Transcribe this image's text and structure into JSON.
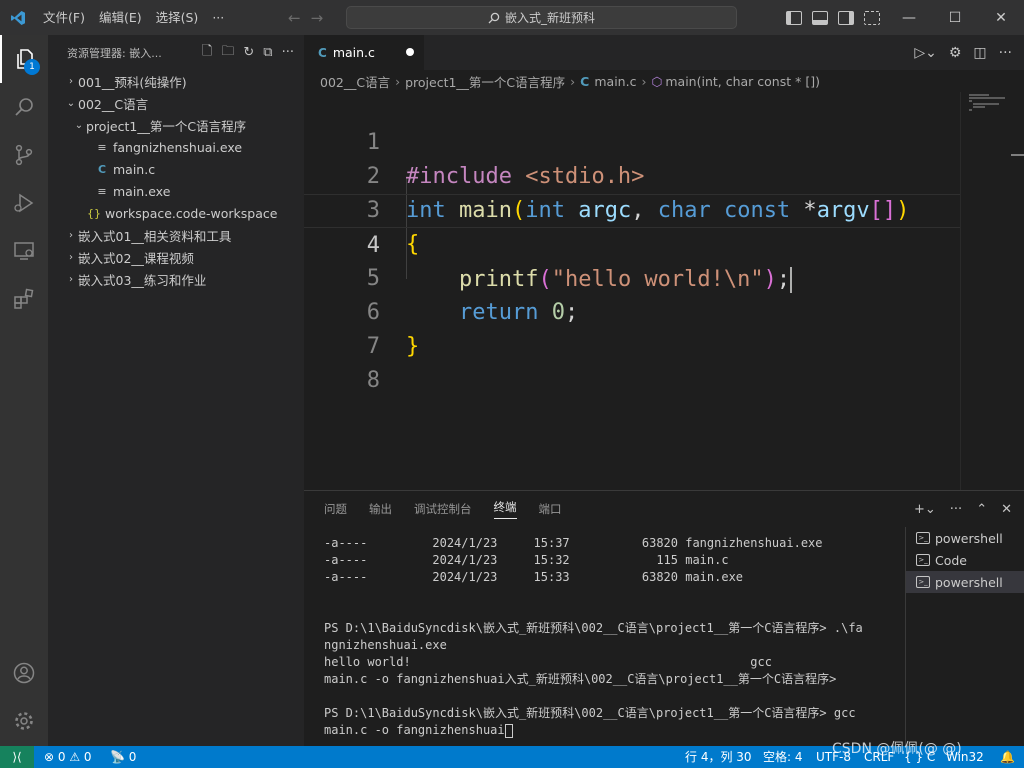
{
  "titlebar": {
    "menu": [
      "文件(F)",
      "编辑(E)",
      "选择(S)",
      "···"
    ],
    "search_text": "嵌入式_新班预科"
  },
  "activity": {
    "explorer_badge": "1"
  },
  "sidebar": {
    "title": "资源管理器: 嵌入...",
    "tree": [
      {
        "label": "001__预科(纯操作)",
        "indent": 0,
        "chev": "›",
        "icon": ""
      },
      {
        "label": "002__C语言",
        "indent": 0,
        "chev": "⌄",
        "icon": ""
      },
      {
        "label": "project1__第一个C语言程序",
        "indent": 1,
        "chev": "⌄",
        "icon": ""
      },
      {
        "label": "fangnizhenshuai.exe",
        "indent": 2,
        "chev": "",
        "icon": "≡"
      },
      {
        "label": "main.c",
        "indent": 2,
        "chev": "",
        "icon": "C"
      },
      {
        "label": "main.exe",
        "indent": 2,
        "chev": "",
        "icon": "≡"
      },
      {
        "label": "workspace.code-workspace",
        "indent": 1,
        "chev": "",
        "icon": "{}"
      },
      {
        "label": "嵌入式01__相关资料和工具",
        "indent": 0,
        "chev": "›",
        "icon": ""
      },
      {
        "label": "嵌入式02__课程视频",
        "indent": 0,
        "chev": "›",
        "icon": ""
      },
      {
        "label": "嵌入式03__练习和作业",
        "indent": 0,
        "chev": "›",
        "icon": ""
      }
    ]
  },
  "editor": {
    "tab_label": "main.c",
    "breadcrumb": [
      "002__C语言",
      "project1__第一个C语言程序",
      "main.c",
      "main(int, char const * [])"
    ],
    "line_numbers": [
      "1",
      "2",
      "3",
      "4",
      "5",
      "6",
      "7",
      "8"
    ],
    "code": {
      "l1_directive": "#include",
      "l1_header": "<stdio.h>",
      "l2_int": "int",
      "l2_main": "main",
      "l2_int2": "int",
      "l2_argc": "argc",
      "l2_char": "char",
      "l2_const": "const",
      "l2_argv": "argv",
      "l3_brace": "{",
      "l4_printf": "printf",
      "l4_string": "\"hello world!\\n\"",
      "l5_return": "return",
      "l5_zero": "0",
      "l6_brace": "}"
    }
  },
  "panel": {
    "tabs": [
      "问题",
      "输出",
      "调试控制台",
      "终端",
      "端口"
    ],
    "active_tab": "终端",
    "terminal_lines": [
      "-a----         2024/1/23     15:37          63820 fangnizhenshuai.exe",
      "-a----         2024/1/23     15:32            115 main.c",
      "-a----         2024/1/23     15:33          63820 main.exe",
      "",
      "",
      "PS D:\\1\\BaiduSyncdisk\\嵌入式_新班预科\\002__C语言\\project1__第一个C语言程序> .\\fa",
      "ngnizhenshuai.exe",
      "hello world!                                               gcc",
      "main.c -o fangnizhenshuai入式_新班预科\\002__C语言\\project1__第一个C语言程序>",
      "",
      "PS D:\\1\\BaiduSyncdisk\\嵌入式_新班预科\\002__C语言\\project1__第一个C语言程序> gcc",
      "main.c -o fangnizhenshuai"
    ],
    "terminals": [
      "powershell",
      "Code",
      "powershell"
    ]
  },
  "statusbar": {
    "problems": "⊗ 0 ⚠ 0",
    "ports": "0",
    "position": "行 4，列 30",
    "spaces": "空格: 4",
    "encoding": "UTF-8",
    "eol": "CRLF",
    "language": "{ } C",
    "platform": "Win32"
  },
  "watermark": "CSDN @佩佩(@      @)"
}
